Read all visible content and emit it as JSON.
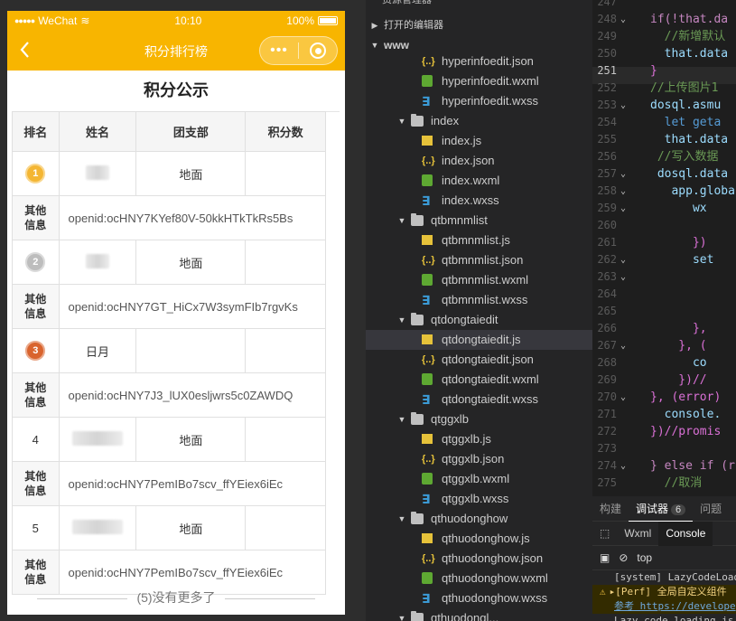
{
  "phone": {
    "status": {
      "carrier": "WeChat",
      "time": "10:10",
      "battery": "100%"
    },
    "nav": {
      "back": "‹",
      "title": "积分排行榜",
      "more": "•••"
    },
    "heading": "积分公示",
    "columns": [
      "排名",
      "姓名",
      "团支部",
      "积分数"
    ],
    "extra_label": "其他信息",
    "rows": [
      {
        "rank": "1",
        "name": "",
        "branch": "地面",
        "score": "",
        "openid": "openid:ocHNY7KYef80V-50kkHTkTkRs5Bs"
      },
      {
        "rank": "2",
        "name": "",
        "branch": "地面",
        "score": "",
        "openid": "openid:ocHNY7GT_HiCx7W3symFIb7rgvKs"
      },
      {
        "rank": "3",
        "name": "日月",
        "branch": "",
        "score": "",
        "openid": "openid:ocHNY7J3_lUX0esljwrs5c0ZAWDQ"
      },
      {
        "rank": "4",
        "name": "",
        "branch": "地面",
        "score": "",
        "openid": "openid:ocHNY7PemIBo7scv_ffYEiex6iEc"
      },
      {
        "rank": "5",
        "name": "",
        "branch": "地面",
        "score": "",
        "openid": "openid:ocHNY7PemIBo7scv_ffYEiex6iEc"
      }
    ],
    "more_tip": "(5)没有更多了",
    "colors": {
      "navbar": "#f8b500",
      "gold": "#f4b633",
      "silver": "#bdbdbd",
      "bronze": "#d9642e"
    }
  },
  "explorer": {
    "section_top": "资源管理器",
    "open_editors": "打开的编辑器",
    "root": "www",
    "items": [
      {
        "label": "hyperinfoedit.json",
        "type": "json",
        "depth": 2
      },
      {
        "label": "hyperinfoedit.wxml",
        "type": "wxml",
        "depth": 2
      },
      {
        "label": "hyperinfoedit.wxss",
        "type": "wxss",
        "depth": 2
      },
      {
        "label": "index",
        "type": "folder",
        "depth": 1
      },
      {
        "label": "index.js",
        "type": "js",
        "depth": 2
      },
      {
        "label": "index.json",
        "type": "json",
        "depth": 2
      },
      {
        "label": "index.wxml",
        "type": "wxml",
        "depth": 2
      },
      {
        "label": "index.wxss",
        "type": "wxss",
        "depth": 2
      },
      {
        "label": "qtbmnmlist",
        "type": "folder",
        "depth": 1
      },
      {
        "label": "qtbmnmlist.js",
        "type": "js",
        "depth": 2
      },
      {
        "label": "qtbmnmlist.json",
        "type": "json",
        "depth": 2
      },
      {
        "label": "qtbmnmlist.wxml",
        "type": "wxml",
        "depth": 2
      },
      {
        "label": "qtbmnmlist.wxss",
        "type": "wxss",
        "depth": 2
      },
      {
        "label": "qtdongtaiedit",
        "type": "folder",
        "depth": 1
      },
      {
        "label": "qtdongtaiedit.js",
        "type": "js",
        "depth": 2,
        "selected": true
      },
      {
        "label": "qtdongtaiedit.json",
        "type": "json",
        "depth": 2
      },
      {
        "label": "qtdongtaiedit.wxml",
        "type": "wxml",
        "depth": 2
      },
      {
        "label": "qtdongtaiedit.wxss",
        "type": "wxss",
        "depth": 2
      },
      {
        "label": "qtggxlb",
        "type": "folder",
        "depth": 1
      },
      {
        "label": "qtggxlb.js",
        "type": "js",
        "depth": 2
      },
      {
        "label": "qtggxlb.json",
        "type": "json",
        "depth": 2
      },
      {
        "label": "qtggxlb.wxml",
        "type": "wxml",
        "depth": 2
      },
      {
        "label": "qtggxlb.wxss",
        "type": "wxss",
        "depth": 2
      },
      {
        "label": "qthuodonghow",
        "type": "folder",
        "depth": 1
      },
      {
        "label": "qthuodonghow.js",
        "type": "js",
        "depth": 2
      },
      {
        "label": "qthuodonghow.json",
        "type": "json",
        "depth": 2
      },
      {
        "label": "qthuodonghow.wxml",
        "type": "wxml",
        "depth": 2
      },
      {
        "label": "qthuodonghow.wxss",
        "type": "wxss",
        "depth": 2
      },
      {
        "label": "qthuodongl...",
        "type": "folder",
        "depth": 1
      }
    ]
  },
  "editor": {
    "lines": [
      {
        "n": "247",
        "code": ""
      },
      {
        "n": "248",
        "fold": true,
        "code": "if(!that.da"
      },
      {
        "n": "249",
        "code": "  //新增默认"
      },
      {
        "n": "250",
        "code": "  that.data"
      },
      {
        "n": "251",
        "code": "}"
      },
      {
        "n": "252",
        "code": "//上传图片1"
      },
      {
        "n": "253",
        "fold": true,
        "code": "dosql.asmu"
      },
      {
        "n": "254",
        "code": "  let geta"
      },
      {
        "n": "255",
        "code": "  that.data"
      },
      {
        "n": "256",
        "code": " //写入数据"
      },
      {
        "n": "257",
        "fold": true,
        "code": " dosql.data"
      },
      {
        "n": "258",
        "fold": true,
        "code": "   app.globa"
      },
      {
        "n": "259",
        "fold": true,
        "code": "      wx"
      },
      {
        "n": "260",
        "code": ""
      },
      {
        "n": "261",
        "code": "      })"
      },
      {
        "n": "262",
        "fold": true,
        "code": "      set"
      },
      {
        "n": "263",
        "fold": true,
        "code": ""
      },
      {
        "n": "264",
        "code": ""
      },
      {
        "n": "265",
        "code": ""
      },
      {
        "n": "266",
        "code": "      },"
      },
      {
        "n": "267",
        "fold": true,
        "code": "    }, ("
      },
      {
        "n": "268",
        "code": "      co"
      },
      {
        "n": "269",
        "code": "    })//"
      },
      {
        "n": "270",
        "fold": true,
        "code": "}, (error)"
      },
      {
        "n": "271",
        "code": "  console."
      },
      {
        "n": "272",
        "code": "})//promis"
      },
      {
        "n": "273",
        "code": ""
      },
      {
        "n": "274",
        "fold": true,
        "code": "} else if (r"
      },
      {
        "n": "275",
        "code": "  //取消"
      }
    ]
  },
  "panel": {
    "tabs": [
      {
        "label": "构建"
      },
      {
        "label": "调试器",
        "active": true,
        "badge": "6"
      },
      {
        "label": "问题"
      }
    ],
    "subtabs": [
      {
        "label": "Wxml"
      },
      {
        "label": "Console",
        "active": true
      }
    ],
    "context": "top",
    "console": [
      {
        "text": "[system] LazyCodeLoad",
        "type": "log"
      },
      {
        "text": "▸[Perf] 全局自定义组件",
        "type": "warn"
      },
      {
        "text": "参考 https://develope",
        "type": "warn-link"
      },
      {
        "text": "Lazy code loading is",
        "type": "log"
      }
    ]
  }
}
